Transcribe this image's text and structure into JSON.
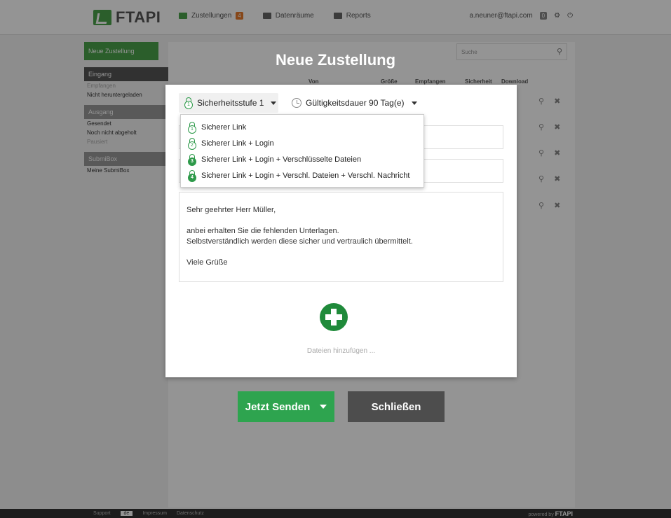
{
  "app": {
    "logo_text": "FTAPI",
    "nav": [
      {
        "label": "Zustellungen",
        "badge": "4"
      },
      {
        "label": "Datenräume"
      },
      {
        "label": "Reports"
      }
    ],
    "user_email": "a.neuner@ftapi.com",
    "user_badge": "0",
    "search_placeholder": "Suche"
  },
  "sidebar": {
    "new_button": "Neue Zustellung",
    "inbox_head": "Eingang",
    "inbox_items": [
      "Empfangen",
      "Nicht heruntergeladen"
    ],
    "outbox_head": "Ausgang",
    "outbox_items": [
      "Gesendet",
      "Noch nicht abgeholt",
      "Pausiert"
    ],
    "submibox_head": "SubmiBox",
    "submibox_items": [
      "Meine SubmiBox"
    ]
  },
  "table_heads": [
    "Von",
    "Größe",
    "Empfangen",
    "Sicherheit",
    "Download"
  ],
  "modal": {
    "title": "Neue Zustellung",
    "security_select": "Sicherheitsstufe 1",
    "security_level_num": "1",
    "validity": "Gültigkeitsdauer 90 Tag(e)",
    "message_lines": [
      "Sehr geehrter Herr Müller,",
      "anbei erhalten Sie die fehlenden Unterlagen.",
      "Selbstverständlich werden diese sicher und vertraulich übermittelt.",
      "Viele Grüße"
    ],
    "add_files_label": "Dateien hinzufügen ..."
  },
  "dropdown": {
    "options": [
      {
        "num": "1",
        "label": "Sicherer Link"
      },
      {
        "num": "2",
        "label": "Sicherer Link + Login"
      },
      {
        "num": "3",
        "label": "Sicherer Link + Login + Verschlüsselte Dateien"
      },
      {
        "num": "4",
        "label": "Sicherer Link + Login + Verschl. Dateien + Verschl. Nachricht"
      }
    ]
  },
  "actions": {
    "send_label": "Jetzt Senden",
    "close_label": "Schließen"
  },
  "footer": {
    "support": "Support",
    "lang": "de",
    "imprint": "Impressum",
    "privacy": "Datenschutz",
    "powered_by": "powered by",
    "powered_brand": "FTAPI"
  },
  "colors": {
    "brand_green": "#2ea44f",
    "dark_button": "#4d4d4d",
    "badge_orange": "#e77a2b"
  }
}
